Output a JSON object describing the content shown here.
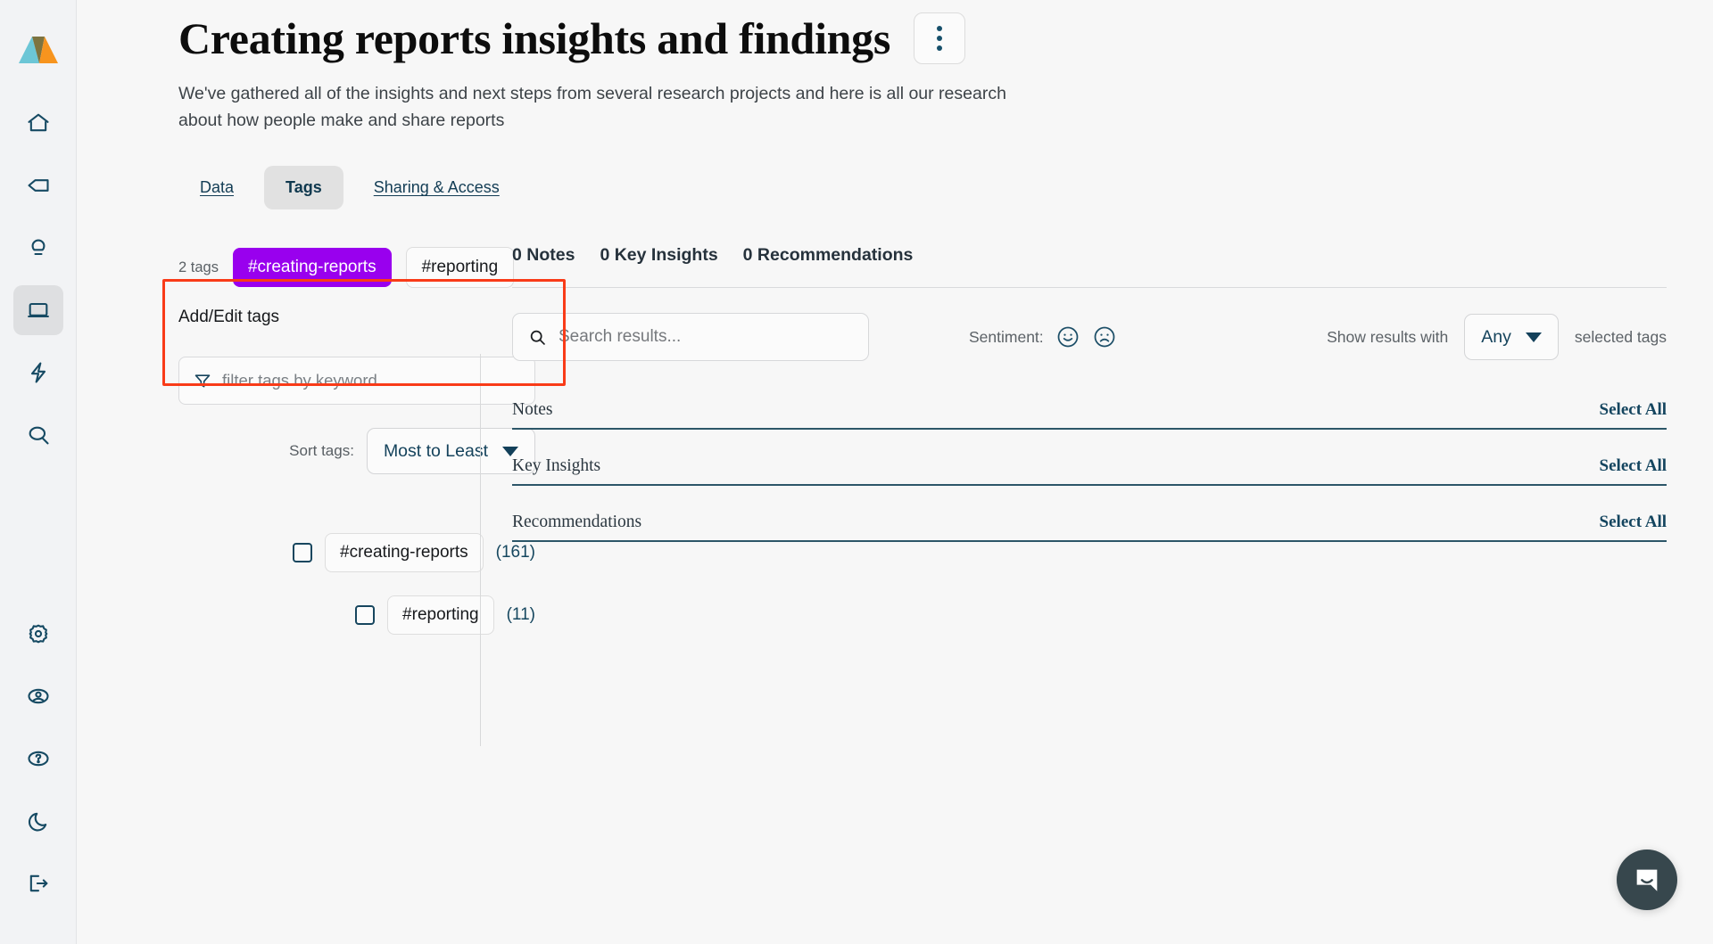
{
  "sidebar": {
    "logo_name": "aurelius-logo",
    "items": [
      {
        "icon": "home-icon",
        "name": "sidebar-item-home",
        "active": false
      },
      {
        "icon": "tag-icon",
        "name": "sidebar-item-tags",
        "active": false
      },
      {
        "icon": "lightbulb-icon",
        "name": "sidebar-item-insights",
        "active": false
      },
      {
        "icon": "book-icon",
        "name": "sidebar-item-reports",
        "active": true
      },
      {
        "icon": "bolt-icon",
        "name": "sidebar-item-activity",
        "active": false
      },
      {
        "icon": "search-icon",
        "name": "sidebar-item-search",
        "active": false
      }
    ],
    "bottom_items": [
      {
        "icon": "gear-icon",
        "name": "sidebar-item-settings"
      },
      {
        "icon": "account-icon",
        "name": "sidebar-item-account"
      },
      {
        "icon": "help-icon",
        "name": "sidebar-item-help"
      },
      {
        "icon": "moon-icon",
        "name": "sidebar-item-dark-mode"
      },
      {
        "icon": "logout-icon",
        "name": "sidebar-item-logout"
      }
    ]
  },
  "header": {
    "title": "Creating reports insights and findings",
    "subtitle": "We've gathered all of the insights and next steps from several research projects and here is all our research about how people make and share reports",
    "menu_label": "more-options"
  },
  "tabs": [
    {
      "label": "Data",
      "active": false
    },
    {
      "label": "Tags",
      "active": true
    },
    {
      "label": "Sharing & Access",
      "active": false
    }
  ],
  "tags_panel": {
    "count_label": "2 tags",
    "applied_tags": [
      {
        "label": "#creating-reports",
        "selected": true
      },
      {
        "label": "#reporting",
        "selected": false
      }
    ],
    "add_edit_label": "Add/Edit tags",
    "filter_placeholder": "filter tags by keyword...",
    "filter_value": "",
    "sort_label": "Sort tags:",
    "sort_value": "Most to Least",
    "tag_list": [
      {
        "label": "#creating-reports",
        "count": "(161)",
        "checked": false
      },
      {
        "label": "#reporting",
        "count": "(11)",
        "checked": false
      }
    ]
  },
  "results": {
    "counters": [
      "0 Notes",
      "0 Key Insights",
      "0 Recommendations"
    ],
    "search_placeholder": "Search results...",
    "search_value": "",
    "sentiment_label": "Sentiment:",
    "sentiment_positive": "smiley-face-icon",
    "sentiment_negative": "frowny-face-icon",
    "show_results_prefix": "Show results with",
    "show_results_value": "Any",
    "show_results_suffix": "selected tags",
    "sections": [
      {
        "title": "Notes",
        "action": "Select All"
      },
      {
        "title": "Key Insights",
        "action": "Select All"
      },
      {
        "title": "Recommendations",
        "action": "Select All"
      }
    ]
  },
  "chat": {
    "name": "intercom-chat-button"
  },
  "colors": {
    "accent_purple": "#9900ee",
    "highlight_red": "#f93b18",
    "teal_dark": "#14455f",
    "logo_teal": "#6cc6d6",
    "logo_orange": "#f7941e",
    "logo_olive": "#7d7340",
    "chat_bg": "#37474d"
  },
  "annotation": {
    "name": "highlight-rectangle"
  }
}
